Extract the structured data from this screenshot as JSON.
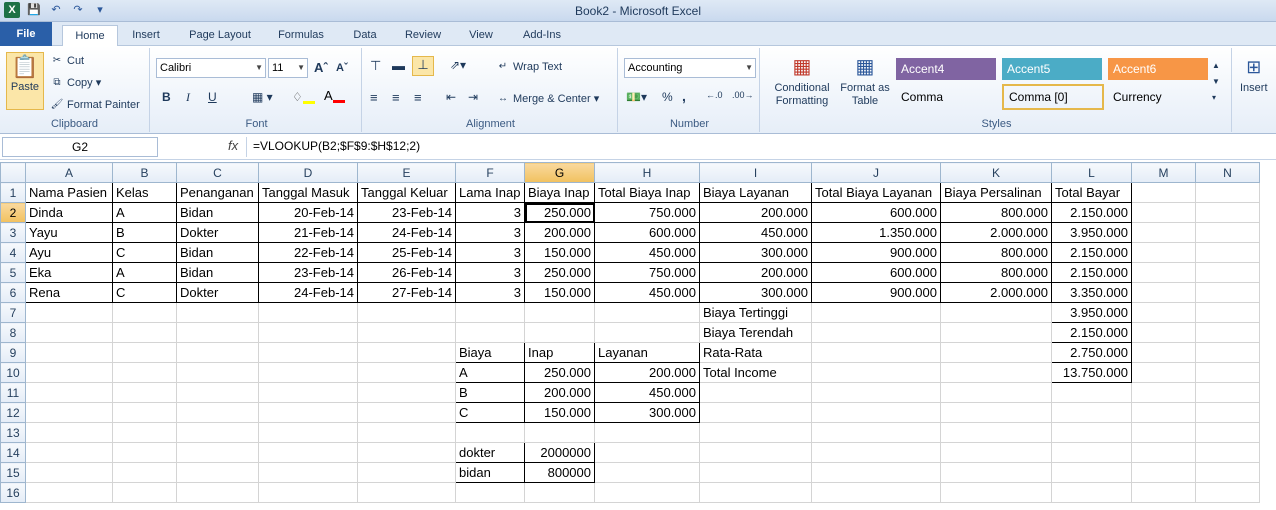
{
  "window": {
    "title": "Book2 - Microsoft Excel"
  },
  "ribbon_tabs": [
    "File",
    "Home",
    "Insert",
    "Page Layout",
    "Formulas",
    "Data",
    "Review",
    "View",
    "Add-Ins"
  ],
  "clipboard": {
    "paste": "Paste",
    "cut": "Cut",
    "copy": "Copy",
    "format_painter": "Format Painter",
    "label": "Clipboard"
  },
  "font": {
    "name": "Calibri",
    "size": "11",
    "label": "Font",
    "bold": "B",
    "italic": "I",
    "underline": "U"
  },
  "alignment": {
    "wrap": "Wrap Text",
    "merge": "Merge & Center",
    "label": "Alignment"
  },
  "number": {
    "format": "Accounting",
    "percent": "%",
    "comma": ",",
    "label": "Number"
  },
  "styles": {
    "conditional": "Conditional Formatting",
    "format_table": "Format as Table",
    "accent4": "Accent4",
    "accent5": "Accent5",
    "accent6": "Accent6",
    "comma": "Comma",
    "comma0": "Comma [0]",
    "currency": "Currency",
    "label": "Styles"
  },
  "cells_group": {
    "insert": "Insert"
  },
  "formula_bar": {
    "name_box": "G2",
    "fx": "fx",
    "formula": "=VLOOKUP(B2;$F$9:$H$12;2)"
  },
  "columns": [
    "A",
    "B",
    "C",
    "D",
    "E",
    "F",
    "G",
    "H",
    "I",
    "J",
    "K",
    "L",
    "M",
    "N"
  ],
  "rows": [
    [
      "Nama Pasien",
      "Kelas",
      "Penanganan",
      "Tanggal Masuk",
      "Tanggal Keluar",
      "Lama Inap",
      "Biaya Inap",
      "Total Biaya Inap",
      "Biaya Layanan",
      "Total Biaya Layanan",
      "Biaya Persalinan",
      "Total Bayar",
      "",
      ""
    ],
    [
      "Dinda",
      "A",
      "Bidan",
      "20-Feb-14",
      "23-Feb-14",
      "3",
      "250.000",
      "750.000",
      "200.000",
      "600.000",
      "800.000",
      "2.150.000",
      "",
      ""
    ],
    [
      "Yayu",
      "B",
      "Dokter",
      "21-Feb-14",
      "24-Feb-14",
      "3",
      "200.000",
      "600.000",
      "450.000",
      "1.350.000",
      "2.000.000",
      "3.950.000",
      "",
      ""
    ],
    [
      "Ayu",
      "C",
      "Bidan",
      "22-Feb-14",
      "25-Feb-14",
      "3",
      "150.000",
      "450.000",
      "300.000",
      "900.000",
      "800.000",
      "2.150.000",
      "",
      ""
    ],
    [
      "Eka",
      "A",
      "Bidan",
      "23-Feb-14",
      "26-Feb-14",
      "3",
      "250.000",
      "750.000",
      "200.000",
      "600.000",
      "800.000",
      "2.150.000",
      "",
      ""
    ],
    [
      "Rena",
      "C",
      "Dokter",
      "24-Feb-14",
      "27-Feb-14",
      "3",
      "150.000",
      "450.000",
      "300.000",
      "900.000",
      "2.000.000",
      "3.350.000",
      "",
      ""
    ],
    [
      "",
      "",
      "",
      "",
      "",
      "",
      "",
      "",
      "Biaya Tertinggi",
      "",
      "",
      "3.950.000",
      "",
      ""
    ],
    [
      "",
      "",
      "",
      "",
      "",
      "",
      "",
      "",
      "Biaya Terendah",
      "",
      "",
      "2.150.000",
      "",
      ""
    ],
    [
      "",
      "",
      "",
      "",
      "",
      "Biaya",
      "Inap",
      "Layanan",
      "Rata-Rata",
      "",
      "",
      "2.750.000",
      "",
      ""
    ],
    [
      "",
      "",
      "",
      "",
      "",
      "A",
      "250.000",
      "200.000",
      "Total Income",
      "",
      "",
      "13.750.000",
      "",
      ""
    ],
    [
      "",
      "",
      "",
      "",
      "",
      "B",
      "200.000",
      "450.000",
      "",
      "",
      "",
      "",
      "",
      ""
    ],
    [
      "",
      "",
      "",
      "",
      "",
      "C",
      "150.000",
      "300.000",
      "",
      "",
      "",
      "",
      "",
      ""
    ],
    [
      "",
      "",
      "",
      "",
      "",
      "",
      "",
      "",
      "",
      "",
      "",
      "",
      "",
      ""
    ],
    [
      "",
      "",
      "",
      "",
      "",
      "dokter",
      "2000000",
      "",
      "",
      "",
      "",
      "",
      "",
      ""
    ],
    [
      "",
      "",
      "",
      "",
      "",
      "bidan",
      "800000",
      "",
      "",
      "",
      "",
      "",
      "",
      ""
    ],
    [
      "",
      "",
      "",
      "",
      "",
      "",
      "",
      "",
      "",
      "",
      "",
      "",
      "",
      ""
    ]
  ]
}
